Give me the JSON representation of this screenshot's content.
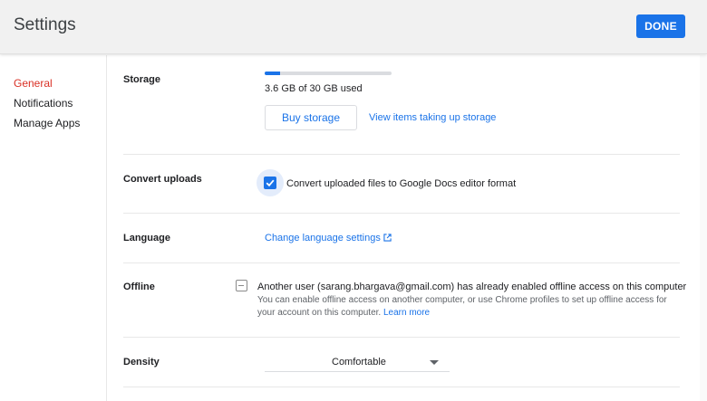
{
  "header": {
    "title": "Settings",
    "done_label": "DONE"
  },
  "sidebar": {
    "items": [
      {
        "label": "General",
        "active": true
      },
      {
        "label": "Notifications",
        "active": false
      },
      {
        "label": "Manage Apps",
        "active": false
      }
    ]
  },
  "storage": {
    "label": "Storage",
    "used_fraction": 0.12,
    "usage_text": "3.6 GB of 30 GB used",
    "buy_label": "Buy storage",
    "view_items_label": "View items taking up storage"
  },
  "convert": {
    "label": "Convert uploads",
    "checked": true,
    "text": "Convert uploaded files to Google Docs editor format"
  },
  "language": {
    "label": "Language",
    "link_label": "Change language settings"
  },
  "offline": {
    "label": "Offline",
    "main_text": "Another user (sarang.bhargava@gmail.com) has already enabled offline access on this computer",
    "sub_text": "You can enable offline access on another computer, or use Chrome profiles to set up offline access for your account on this computer.",
    "learn_more": "Learn more"
  },
  "density": {
    "label": "Density",
    "selected": "Comfortable"
  },
  "colors": {
    "accent": "#1a73e8",
    "active_nav": "#d93025",
    "header_bg": "#f1f1f1"
  }
}
